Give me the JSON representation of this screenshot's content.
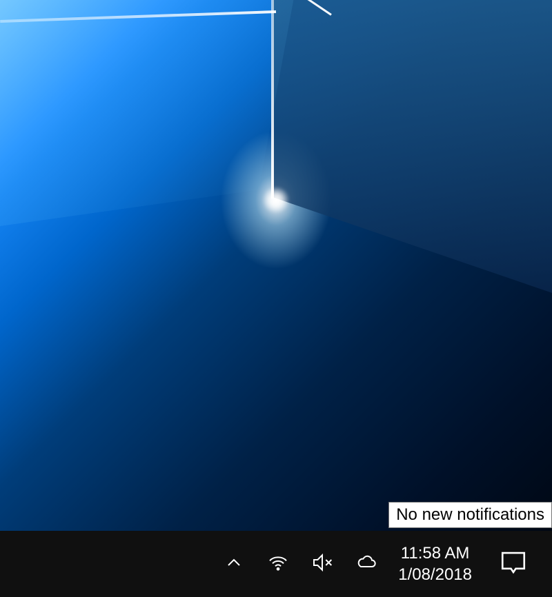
{
  "tooltip": {
    "text": "No new notifications"
  },
  "clock": {
    "time": "11:58 AM",
    "date": "1/08/2018"
  },
  "tray": {
    "overflow_label": "Show hidden icons",
    "wifi_label": "Network",
    "volume_label": "Volume muted",
    "onedrive_label": "OneDrive",
    "action_center_label": "Action Center"
  }
}
